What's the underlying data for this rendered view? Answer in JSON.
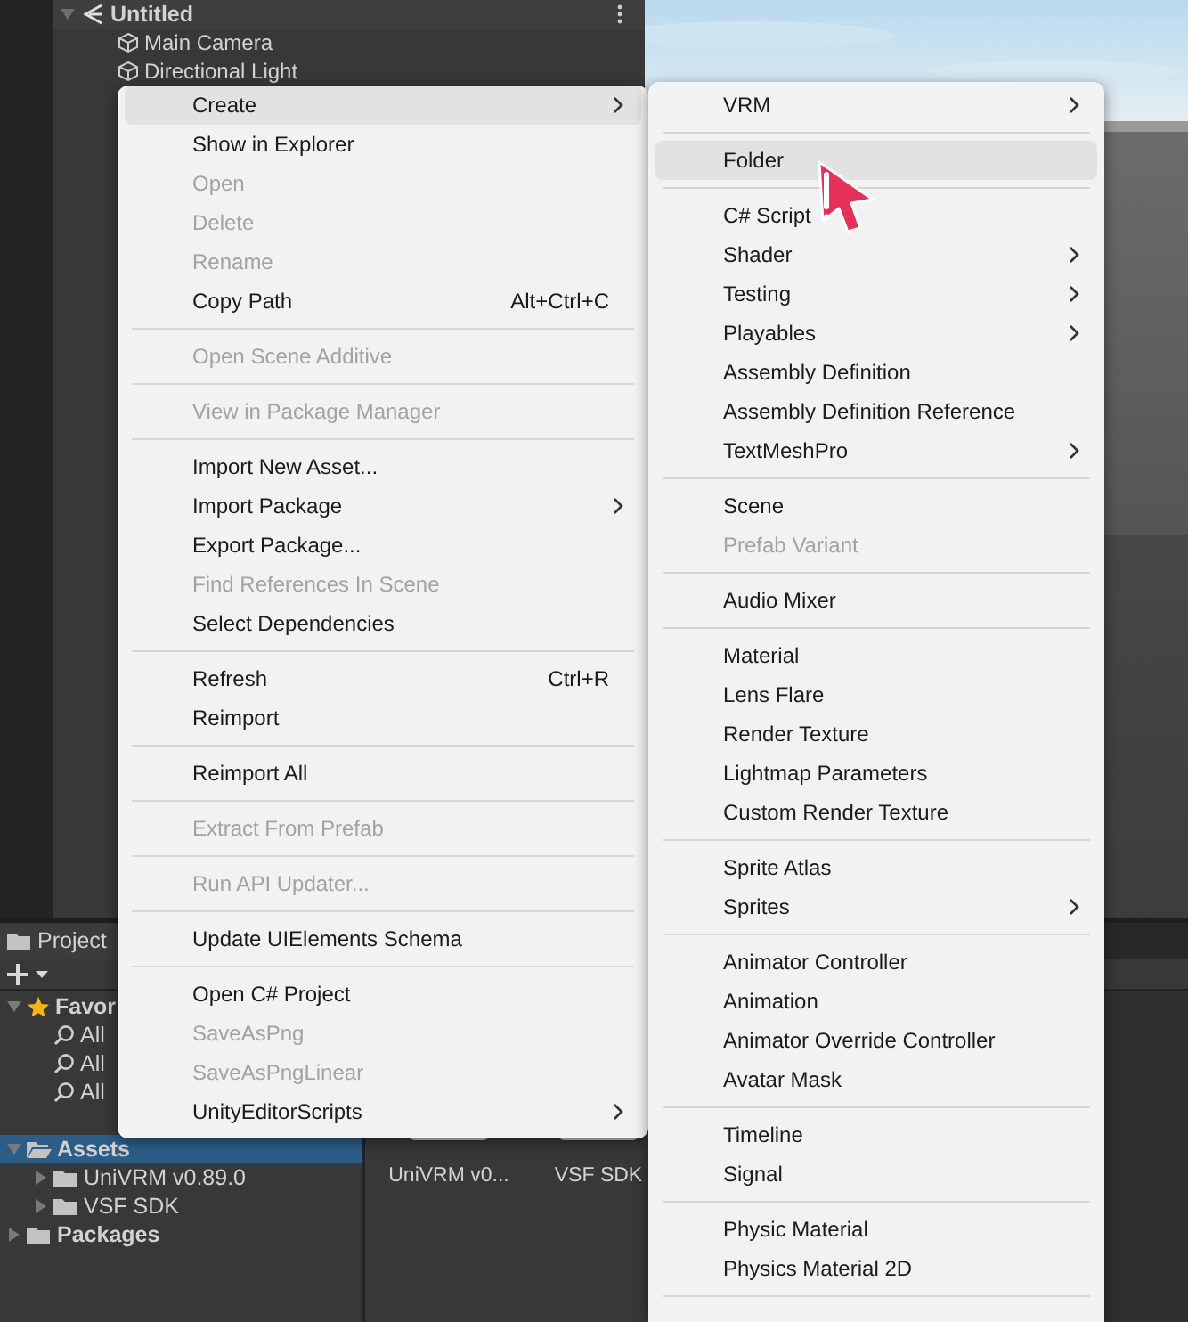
{
  "hierarchy": {
    "scene": "Untitled",
    "objects": [
      "Main Camera",
      "Directional Light"
    ]
  },
  "project": {
    "tab": "Project",
    "favorites": {
      "label": "Favor",
      "expanded": true,
      "items": [
        "All",
        "All",
        "All"
      ]
    },
    "tree": [
      {
        "label": "Assets",
        "selected": true,
        "expanded": true,
        "children": [
          {
            "label": "UniVRM v0.89.0",
            "selected": false,
            "expanded": false
          },
          {
            "label": "VSF SDK",
            "selected": false,
            "expanded": false
          }
        ]
      },
      {
        "label": "Packages",
        "selected": false,
        "expanded": false
      }
    ],
    "grid": [
      {
        "label": "UniVRM v0..."
      },
      {
        "label": "VSF SDK"
      }
    ]
  },
  "context_menu": {
    "groups": [
      {
        "items": [
          {
            "label": "Create",
            "submenu": true,
            "selected": true,
            "disabled": false
          },
          {
            "label": "Show in Explorer",
            "submenu": false,
            "selected": false,
            "disabled": false
          },
          {
            "label": "Open",
            "submenu": false,
            "selected": false,
            "disabled": true
          },
          {
            "label": "Delete",
            "submenu": false,
            "selected": false,
            "disabled": true
          },
          {
            "label": "Rename",
            "submenu": false,
            "selected": false,
            "disabled": true
          },
          {
            "label": "Copy Path",
            "shortcut": "Alt+Ctrl+C",
            "submenu": false,
            "selected": false,
            "disabled": false
          }
        ]
      },
      {
        "items": [
          {
            "label": "Open Scene Additive",
            "submenu": false,
            "selected": false,
            "disabled": true
          }
        ]
      },
      {
        "items": [
          {
            "label": "View in Package Manager",
            "submenu": false,
            "selected": false,
            "disabled": true
          }
        ]
      },
      {
        "items": [
          {
            "label": "Import New Asset...",
            "submenu": false,
            "selected": false,
            "disabled": false
          },
          {
            "label": "Import Package",
            "submenu": true,
            "selected": false,
            "disabled": false
          },
          {
            "label": "Export Package...",
            "submenu": false,
            "selected": false,
            "disabled": false
          },
          {
            "label": "Find References In Scene",
            "submenu": false,
            "selected": false,
            "disabled": true
          },
          {
            "label": "Select Dependencies",
            "submenu": false,
            "selected": false,
            "disabled": false
          }
        ]
      },
      {
        "items": [
          {
            "label": "Refresh",
            "shortcut": "Ctrl+R",
            "submenu": false,
            "selected": false,
            "disabled": false
          },
          {
            "label": "Reimport",
            "submenu": false,
            "selected": false,
            "disabled": false
          }
        ]
      },
      {
        "items": [
          {
            "label": "Reimport All",
            "submenu": false,
            "selected": false,
            "disabled": false
          }
        ]
      },
      {
        "items": [
          {
            "label": "Extract From Prefab",
            "submenu": false,
            "selected": false,
            "disabled": true
          }
        ]
      },
      {
        "items": [
          {
            "label": "Run API Updater...",
            "submenu": false,
            "selected": false,
            "disabled": true
          }
        ]
      },
      {
        "items": [
          {
            "label": "Update UIElements Schema",
            "submenu": false,
            "selected": false,
            "disabled": false
          }
        ]
      },
      {
        "items": [
          {
            "label": "Open C# Project",
            "submenu": false,
            "selected": false,
            "disabled": false
          },
          {
            "label": "SaveAsPng",
            "submenu": false,
            "selected": false,
            "disabled": true
          },
          {
            "label": "SaveAsPngLinear",
            "submenu": false,
            "selected": false,
            "disabled": true
          },
          {
            "label": "UnityEditorScripts",
            "submenu": true,
            "selected": false,
            "disabled": false
          }
        ]
      }
    ]
  },
  "create_submenu": {
    "groups": [
      {
        "items": [
          {
            "label": "VRM",
            "submenu": true,
            "selected": false,
            "disabled": false
          }
        ]
      },
      {
        "items": [
          {
            "label": "Folder",
            "submenu": false,
            "selected": true,
            "disabled": false
          }
        ]
      },
      {
        "items": [
          {
            "label": "C# Script",
            "submenu": false,
            "selected": false,
            "disabled": false
          },
          {
            "label": "Shader",
            "submenu": true,
            "selected": false,
            "disabled": false
          },
          {
            "label": "Testing",
            "submenu": true,
            "selected": false,
            "disabled": false
          },
          {
            "label": "Playables",
            "submenu": true,
            "selected": false,
            "disabled": false
          },
          {
            "label": "Assembly Definition",
            "submenu": false,
            "selected": false,
            "disabled": false
          },
          {
            "label": "Assembly Definition Reference",
            "submenu": false,
            "selected": false,
            "disabled": false
          },
          {
            "label": "TextMeshPro",
            "submenu": true,
            "selected": false,
            "disabled": false
          }
        ]
      },
      {
        "items": [
          {
            "label": "Scene",
            "submenu": false,
            "selected": false,
            "disabled": false
          },
          {
            "label": "Prefab Variant",
            "submenu": false,
            "selected": false,
            "disabled": true
          }
        ]
      },
      {
        "items": [
          {
            "label": "Audio Mixer",
            "submenu": false,
            "selected": false,
            "disabled": false
          }
        ]
      },
      {
        "items": [
          {
            "label": "Material",
            "submenu": false,
            "selected": false,
            "disabled": false
          },
          {
            "label": "Lens Flare",
            "submenu": false,
            "selected": false,
            "disabled": false
          },
          {
            "label": "Render Texture",
            "submenu": false,
            "selected": false,
            "disabled": false
          },
          {
            "label": "Lightmap Parameters",
            "submenu": false,
            "selected": false,
            "disabled": false
          },
          {
            "label": "Custom Render Texture",
            "submenu": false,
            "selected": false,
            "disabled": false
          }
        ]
      },
      {
        "items": [
          {
            "label": "Sprite Atlas",
            "submenu": false,
            "selected": false,
            "disabled": false
          },
          {
            "label": "Sprites",
            "submenu": true,
            "selected": false,
            "disabled": false
          }
        ]
      },
      {
        "items": [
          {
            "label": "Animator Controller",
            "submenu": false,
            "selected": false,
            "disabled": false
          },
          {
            "label": "Animation",
            "submenu": false,
            "selected": false,
            "disabled": false
          },
          {
            "label": "Animator Override Controller",
            "submenu": false,
            "selected": false,
            "disabled": false
          },
          {
            "label": "Avatar Mask",
            "submenu": false,
            "selected": false,
            "disabled": false
          }
        ]
      },
      {
        "items": [
          {
            "label": "Timeline",
            "submenu": false,
            "selected": false,
            "disabled": false
          },
          {
            "label": "Signal",
            "submenu": false,
            "selected": false,
            "disabled": false
          }
        ]
      },
      {
        "items": [
          {
            "label": "Physic Material",
            "submenu": false,
            "selected": false,
            "disabled": false
          },
          {
            "label": "Physics Material 2D",
            "submenu": false,
            "selected": false,
            "disabled": false
          }
        ]
      }
    ]
  }
}
